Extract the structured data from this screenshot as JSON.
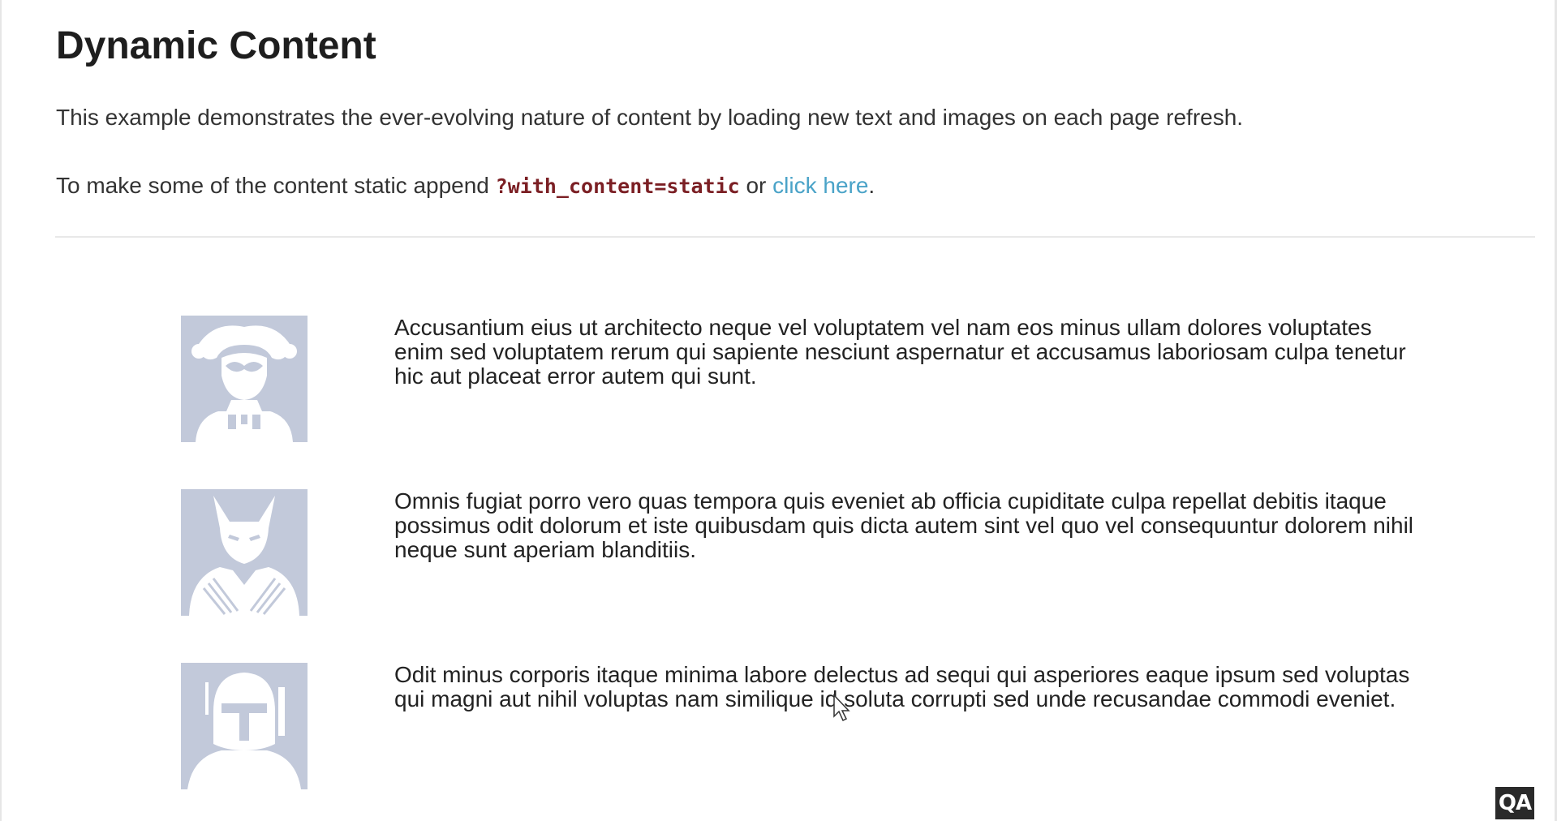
{
  "page": {
    "title": "Dynamic Content",
    "description": "This example demonstrates the ever-evolving nature of content by loading new text and images on each page refresh.",
    "static_prefix": "To make some of the content static append ",
    "static_param": "?with_content=static",
    "static_or": " or ",
    "static_link": "click here",
    "static_suffix": "."
  },
  "rows": [
    {
      "avatar_icon": "jester-avatar-icon",
      "text": "Accusantium eius ut architecto neque vel voluptatem vel nam eos minus ullam dolores voluptates enim sed voluptatem rerum qui sapiente nesciunt aspernatur et accusamus laboriosam culpa tenetur hic aut placeat error autem qui sunt."
    },
    {
      "avatar_icon": "clawed-hero-avatar-icon",
      "text": "Omnis fugiat porro vero quas tempora quis eveniet ab officia cupiditate culpa repellat debitis itaque possimus odit dolorum et iste quibusdam quis dicta autem sint vel quo vel consequuntur dolorem nihil neque sunt aperiam blanditiis."
    },
    {
      "avatar_icon": "helmet-avatar-icon",
      "text": "Odit minus corporis itaque minima labore delectus ad sequi qui asperiores eaque ipsum sed voluptas qui magni aut nihil voluptas nam similique id soluta corrupti sed unde recusandae commodi eveniet."
    }
  ],
  "watermark": {
    "logo_text": "QA"
  },
  "colors": {
    "avatar_bg": "#c2c9da",
    "link": "#4aa3c8",
    "code": "#7b1f24",
    "divider": "#e8e8e8"
  }
}
